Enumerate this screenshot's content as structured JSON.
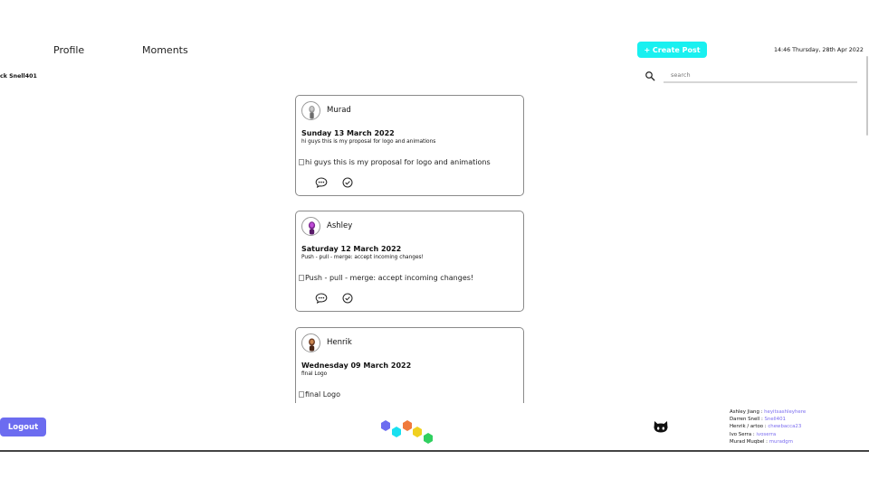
{
  "nav": {
    "profile": "Profile",
    "moments": "Moments"
  },
  "header": {
    "create_post": "+ Create Post",
    "datetime": "14:46 Thursday, 28th Apr 2022",
    "username": "ck Snell401"
  },
  "search": {
    "placeholder": "search"
  },
  "posts": [
    {
      "author": "Murad",
      "date": "Sunday 13 March 2022",
      "caption": "hi guys this is my proposal for logo and animations",
      "image_alt": "hi guys this is my proposal for logo and animations"
    },
    {
      "author": "Ashley",
      "date": "Saturday 12 March 2022",
      "caption": "Push - pull - merge: accept incoming changes!",
      "image_alt": "Push - pull - merge: accept incoming changes!"
    },
    {
      "author": "Henrik",
      "date": "Wednesday 09 March 2022",
      "caption": "final Logo",
      "image_alt": "final Logo"
    }
  ],
  "footer": {
    "logout": "Logout",
    "credits": [
      {
        "name": "Ashley Jiang : ",
        "handle": "heyitsashleyhere"
      },
      {
        "name": "Darren Snell : ",
        "handle": "Snell401"
      },
      {
        "name": "Henrik / artoo : ",
        "handle": "chewbacca23"
      },
      {
        "name": "Ivo Serra : ",
        "handle": "ivoserra"
      },
      {
        "name": "Murad Muqbel : ",
        "handle": "muradgm"
      }
    ]
  },
  "icons": {
    "search": "search-icon",
    "comment": "comment-icon",
    "check": "check-circle-icon",
    "github": "github-icon",
    "logo": "hexagon-logo"
  },
  "colors": {
    "create_post_bg": "#19f0f0",
    "logout_bg": "#6c6cf0",
    "handle_link": "#7a6cf0",
    "logo_hexagons": [
      "#6c6cf0",
      "#19e0f0",
      "#f07a3c",
      "#f0d020",
      "#30d060"
    ]
  }
}
